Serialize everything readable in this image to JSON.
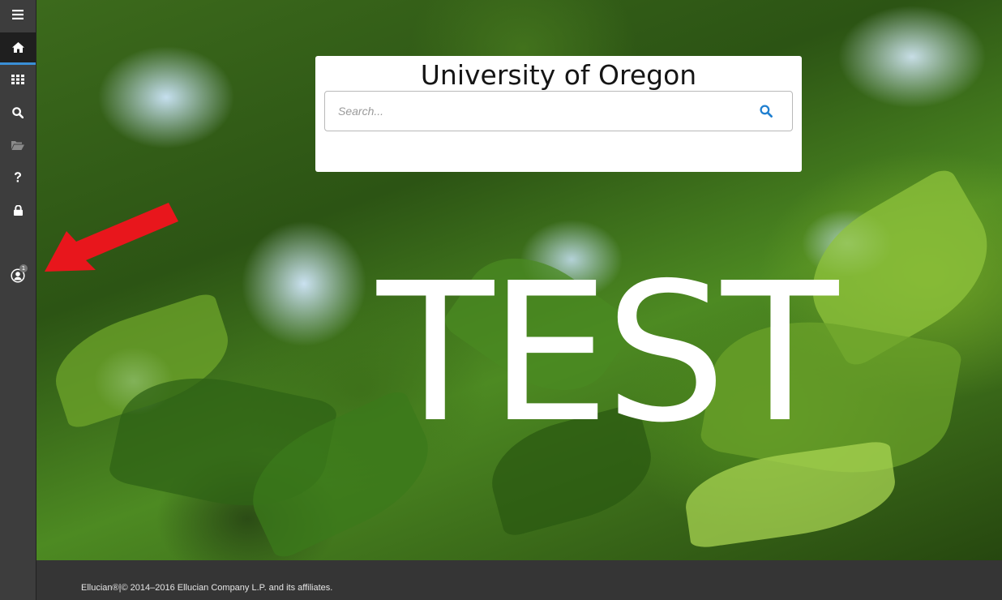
{
  "sidebar": {
    "items": [
      {
        "id": "menu",
        "icon": "hamburger-menu-icon"
      },
      {
        "id": "home",
        "icon": "home-icon",
        "active": true
      },
      {
        "id": "apps",
        "icon": "grid-icon"
      },
      {
        "id": "search",
        "icon": "search-icon"
      },
      {
        "id": "recent",
        "icon": "folder-open-icon"
      },
      {
        "id": "help",
        "icon": "question-icon"
      },
      {
        "id": "lock",
        "icon": "lock-icon"
      },
      {
        "id": "user",
        "icon": "user-circle-icon",
        "badge": "1"
      }
    ],
    "accent_color": "#3a8fd6"
  },
  "hero": {
    "overlay_text": "TEST"
  },
  "search_card": {
    "title": "University of Oregon",
    "placeholder": "Search...",
    "value": ""
  },
  "annotation": {
    "type": "red-arrow",
    "color": "#e8161c"
  },
  "footer": {
    "text": "Ellucian®|© 2014–2016 Ellucian Company L.P. and its affiliates."
  }
}
